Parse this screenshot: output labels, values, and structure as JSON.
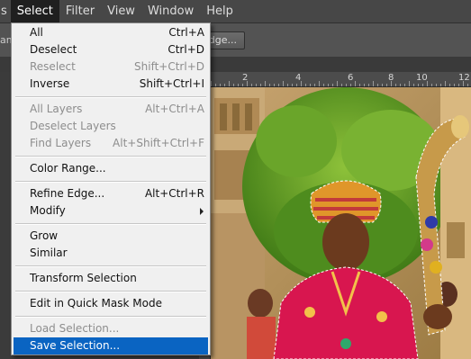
{
  "menubar": {
    "items": [
      {
        "label": "s"
      },
      {
        "label": "Select"
      },
      {
        "label": "Filter"
      },
      {
        "label": "View"
      },
      {
        "label": "Window"
      },
      {
        "label": "Help"
      }
    ]
  },
  "options": {
    "refine_button_label": "dge...",
    "left_fragment": "am"
  },
  "ruler": {
    "top_labels": [
      "2",
      "4",
      "6",
      "8",
      "10",
      "12"
    ]
  },
  "menu": {
    "items": [
      {
        "label": "All",
        "shortcut": "Ctrl+A",
        "enabled": true
      },
      {
        "label": "Deselect",
        "shortcut": "Ctrl+D",
        "enabled": true
      },
      {
        "label": "Reselect",
        "shortcut": "Shift+Ctrl+D",
        "enabled": false
      },
      {
        "label": "Inverse",
        "shortcut": "Shift+Ctrl+I",
        "enabled": true
      },
      {
        "label": "All Layers",
        "shortcut": "Alt+Ctrl+A",
        "enabled": false
      },
      {
        "label": "Deselect Layers",
        "shortcut": "",
        "enabled": false
      },
      {
        "label": "Find Layers",
        "shortcut": "Alt+Shift+Ctrl+F",
        "enabled": false
      },
      {
        "label": "Color Range...",
        "shortcut": "",
        "enabled": true
      },
      {
        "label": "Refine Edge...",
        "shortcut": "Alt+Ctrl+R",
        "enabled": true
      },
      {
        "label": "Modify",
        "shortcut": "",
        "enabled": true,
        "submenu": true
      },
      {
        "label": "Grow",
        "shortcut": "",
        "enabled": true
      },
      {
        "label": "Similar",
        "shortcut": "",
        "enabled": true
      },
      {
        "label": "Transform Selection",
        "shortcut": "",
        "enabled": true
      },
      {
        "label": "Edit in Quick Mask Mode",
        "shortcut": "",
        "enabled": true
      },
      {
        "label": "Load Selection...",
        "shortcut": "",
        "enabled": false
      },
      {
        "label": "Save Selection...",
        "shortcut": "",
        "enabled": true,
        "highlighted": true
      }
    ]
  },
  "colors": {
    "menubar_bg": "#474747",
    "menu_bg": "#f0f0f0",
    "highlight": "#0a64c2",
    "selection_marquee": "#ffffff"
  },
  "icons": {
    "submenu": "chevron-right-icon"
  }
}
